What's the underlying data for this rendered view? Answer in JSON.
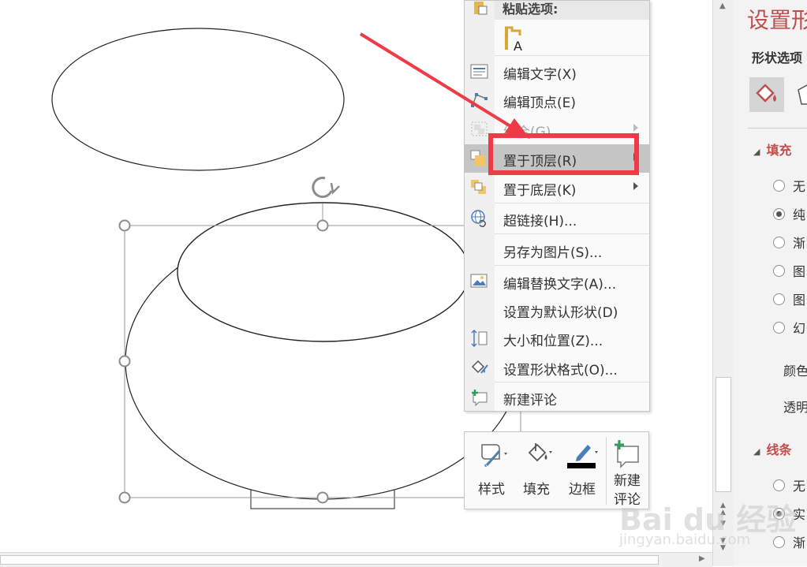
{
  "context_menu": {
    "paste_header": "粘贴选项:",
    "items": [
      {
        "label": "编辑文字(X)",
        "enabled": true,
        "submenu": false
      },
      {
        "label": "编辑顶点(E)",
        "enabled": true,
        "submenu": false
      },
      {
        "label": "组合(G)",
        "enabled": false,
        "submenu": true
      },
      {
        "label": "置于顶层(R)",
        "enabled": true,
        "submenu": true,
        "highlighted": true
      },
      {
        "label": "置于底层(K)",
        "enabled": true,
        "submenu": true
      },
      {
        "label": "超链接(H)...",
        "enabled": true,
        "submenu": false
      },
      {
        "label": "另存为图片(S)...",
        "enabled": true,
        "submenu": false
      },
      {
        "label": "编辑替换文字(A)...",
        "enabled": true,
        "submenu": false
      },
      {
        "label": "设置为默认形状(D)",
        "enabled": true,
        "submenu": false
      },
      {
        "label": "大小和位置(Z)...",
        "enabled": true,
        "submenu": false
      },
      {
        "label": "设置形状格式(O)...",
        "enabled": true,
        "submenu": false
      },
      {
        "label": "新建评论",
        "enabled": true,
        "submenu": false
      }
    ]
  },
  "mini_toolbar": {
    "style_label": "样式",
    "fill_label": "填充",
    "border_label": "边框",
    "comment_label_1": "新建",
    "comment_label_2": "评论"
  },
  "format_panel": {
    "title": "设置形",
    "subtitle": "形状选项",
    "fill_section": "填充",
    "fill_options": [
      "无",
      "纯",
      "渐",
      "图",
      "图",
      "幻"
    ],
    "fill_selected": 1,
    "color_label": "颜色",
    "transparency_label": "透明",
    "line_section": "线条",
    "line_options": [
      "无",
      "实",
      "渐"
    ],
    "line_selected": 1
  },
  "watermark": {
    "text": "Bai du 经验",
    "sub": "jingyan.baidu.com"
  },
  "colors": {
    "accent": "#c0504d",
    "annotation": "#ef3b47",
    "highlight": "#c5c5c5"
  }
}
